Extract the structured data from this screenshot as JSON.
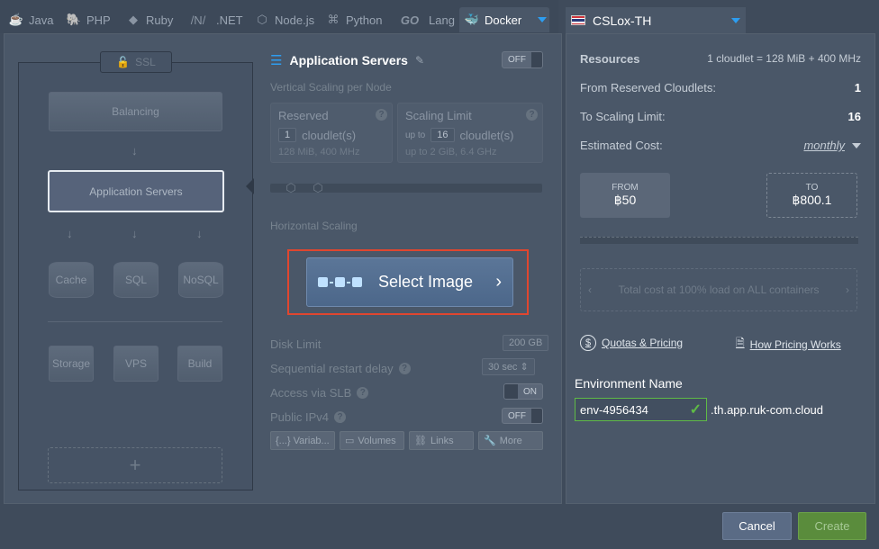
{
  "tabs": [
    {
      "label": "Java",
      "icon": "java-icon"
    },
    {
      "label": "PHP",
      "icon": "php-icon"
    },
    {
      "label": "Ruby",
      "icon": "ruby-icon"
    },
    {
      "label": ".NET",
      "icon": "dotnet-icon"
    },
    {
      "label": "Node.js",
      "icon": "nodejs-icon"
    },
    {
      "label": "Python",
      "icon": "python-icon"
    },
    {
      "label": "Lang",
      "icon": "go-icon",
      "prefix": "GO"
    },
    {
      "label": "Docker",
      "icon": "docker-icon"
    }
  ],
  "topology": {
    "ssl_label": "SSL",
    "balancing": "Balancing",
    "app_servers": "Application Servers",
    "cache": "Cache",
    "sql": "SQL",
    "nosql": "NoSQL",
    "storage": "Storage",
    "vps": "VPS",
    "build": "Build",
    "add": "+"
  },
  "settings": {
    "title": "Application Servers",
    "ha_toggle": "OFF",
    "vertical_label": "Vertical Scaling per Node",
    "reserved": {
      "label": "Reserved",
      "value": "1",
      "unit": "cloudlet(s)",
      "sub": "128 MiB, 400 MHz"
    },
    "limit": {
      "label": "Scaling Limit",
      "prefix": "up to",
      "value": "16",
      "unit": "cloudlet(s)",
      "sub": "up to 2 GiB, 6.4 GHz"
    },
    "horizontal_label": "Horizontal Scaling",
    "select_image": "Select Image",
    "disk_limit": {
      "label": "Disk Limit",
      "value": "200",
      "unit": "GB"
    },
    "restart_delay": {
      "label": "Sequential restart delay",
      "value": "30",
      "unit": "sec"
    },
    "slb": {
      "label": "Access via SLB",
      "value": "ON"
    },
    "ipv4": {
      "label": "Public IPv4",
      "value": "OFF"
    },
    "tools": [
      "{...} Variab...",
      "Volumes",
      "Links",
      "More"
    ]
  },
  "region": {
    "name": "CSLox-TH"
  },
  "resources": {
    "title": "Resources",
    "formula": "1 cloudlet = 128 MiB + 400 MHz",
    "reserved_label": "From Reserved Cloudlets:",
    "reserved_value": "1",
    "limit_label": "To Scaling Limit:",
    "limit_value": "16",
    "cost_label": "Estimated Cost:",
    "cost_period": "monthly",
    "from_label": "FROM",
    "from_value": "฿50",
    "to_label": "TO",
    "to_value": "฿800.1",
    "total_note": "Total cost at 100% load on ALL containers",
    "quotas_link": "Quotas & Pricing",
    "how_link": "How Pricing Works"
  },
  "environment": {
    "label": "Environment Name",
    "value": "env-4956434",
    "suffix": ".th.app.ruk-com.cloud"
  },
  "footer": {
    "cancel": "Cancel",
    "create": "Create"
  }
}
